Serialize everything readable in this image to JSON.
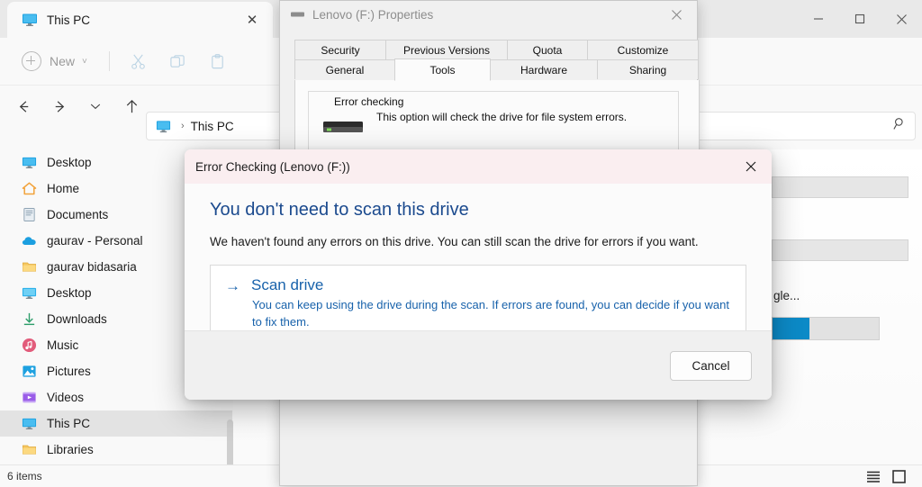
{
  "explorer": {
    "tab": {
      "label": "This PC",
      "icon": "this-pc-icon",
      "close": "✕"
    },
    "window_controls": {
      "minimize": "─",
      "maximize": "☐",
      "close": "✕"
    },
    "toolbar": {
      "new_label": "New",
      "new_chevron": "˅",
      "cut_icon": "scissors-icon",
      "copy_icon": "copy-icon",
      "paste_icon": "paste-icon"
    },
    "nav": {
      "back": "←",
      "forward": "→",
      "recent": "˅",
      "up": "↑"
    },
    "breadcrumb": {
      "icon": "this-pc-icon",
      "separator": "›",
      "text": "This PC"
    },
    "search_icon": "search-icon",
    "sidebar": [
      {
        "label": "Desktop",
        "icon": "monitor",
        "selected": false
      },
      {
        "label": "Home",
        "icon": "home",
        "selected": false
      },
      {
        "label": "Documents",
        "icon": "document",
        "selected": false
      },
      {
        "label": "gaurav - Personal",
        "icon": "onedrive",
        "selected": false
      },
      {
        "label": "gaurav bidasaria",
        "icon": "folder",
        "selected": false
      },
      {
        "label": "Desktop",
        "icon": "desktop2",
        "selected": false
      },
      {
        "label": "Downloads",
        "icon": "download",
        "selected": false
      },
      {
        "label": "Music",
        "icon": "music",
        "selected": false
      },
      {
        "label": "Pictures",
        "icon": "picture",
        "selected": false
      },
      {
        "label": "Videos",
        "icon": "video",
        "selected": false
      },
      {
        "label": "This PC",
        "icon": "monitor",
        "selected": true
      },
      {
        "label": "Libraries",
        "icon": "folder",
        "selected": false
      }
    ],
    "content": {
      "partial_drive_label": "gle...",
      "capacity_fill_percent": 35,
      "accent_color": "#0c8ac7"
    },
    "status": {
      "items_text": "6 items",
      "details_view_icon": "details-view-icon",
      "large_icons_view_icon": "large-icons-view-icon"
    }
  },
  "properties": {
    "title": "Lenovo (F:) Properties",
    "title_icon": "drive-icon",
    "close": "✕",
    "tabs_back": [
      "Security",
      "Previous Versions",
      "Quota",
      "Customize"
    ],
    "tabs_front": [
      "General",
      "Tools",
      "Hardware",
      "Sharing"
    ],
    "active_tab": "Tools",
    "group_legend": "Error checking",
    "group_text": "This option will check the drive for file system errors.",
    "drive_icon": "hard-drive-icon"
  },
  "error_checking": {
    "title": "Error Checking (Lenovo (F:))",
    "close": "✕",
    "heading": "You don't need to scan this drive",
    "subtext": "We haven't found any errors on this drive. You can still scan the drive for errors if you want.",
    "scan": {
      "arrow": "→",
      "title": "Scan drive",
      "description": "You can keep using the drive during the scan. If errors are found, you can decide if you want to fix them."
    },
    "cancel_label": "Cancel",
    "title_bar_color": "#faeef0",
    "heading_color": "#1b4a8e",
    "link_color": "#1862ab"
  }
}
